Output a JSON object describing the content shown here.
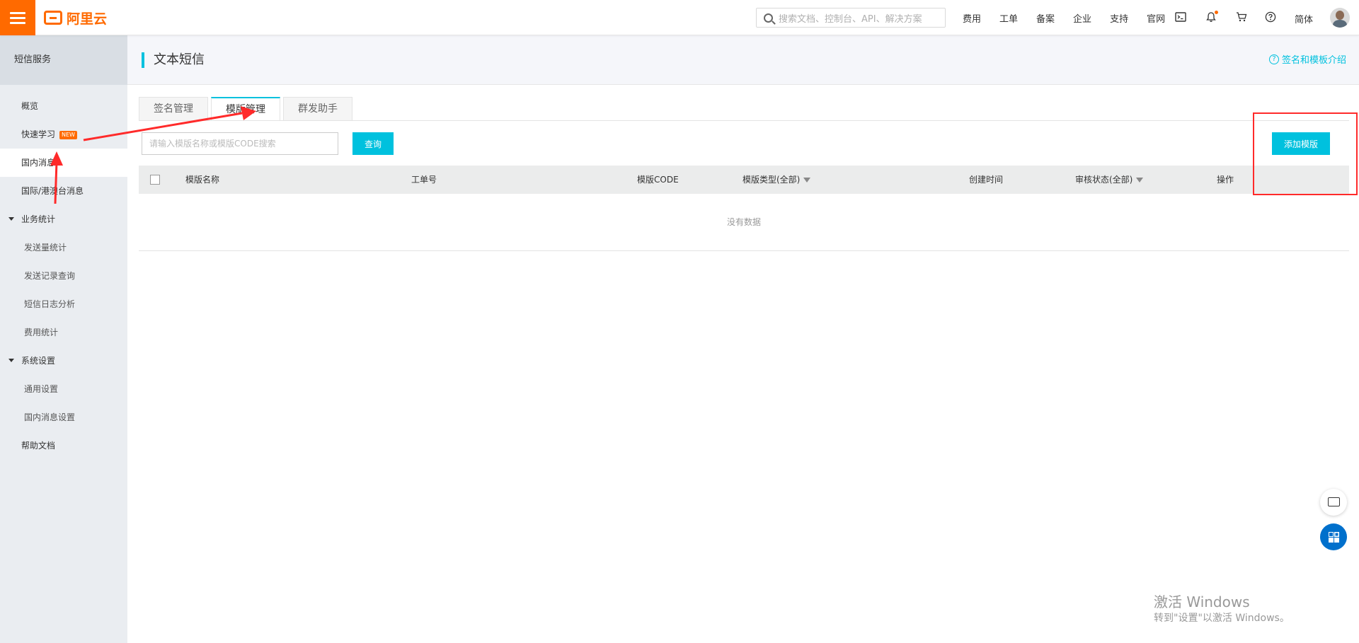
{
  "topbar": {
    "logo_text": "阿里云",
    "search_placeholder": "搜索文档、控制台、API、解决方案",
    "links": [
      "费用",
      "工单",
      "备案",
      "企业",
      "支持",
      "官网"
    ],
    "lang": "简体",
    "accent_color": "#ff6a00"
  },
  "sidebar": {
    "title": "短信服务",
    "items": [
      {
        "label": "概览"
      },
      {
        "label": "快速学习",
        "badge": "NEW"
      },
      {
        "label": "国内消息"
      },
      {
        "label": "国际/港澳台消息"
      }
    ],
    "stats_group": "业务统计",
    "stats_items": [
      "发送量统计",
      "发送记录查询",
      "短信日志分析",
      "费用统计"
    ],
    "settings_group": "系统设置",
    "settings_items": [
      "通用设置",
      "国内消息设置"
    ],
    "help": "帮助文档"
  },
  "header": {
    "title": "文本短信",
    "help_link": "签名和模板介绍"
  },
  "tabs": [
    "签名管理",
    "模版管理",
    "群发助手"
  ],
  "toolbar": {
    "search_placeholder": "请输入模版名称或模版CODE搜索",
    "query_label": "查询",
    "add_label": "添加模版",
    "primary_color": "#00c1de"
  },
  "table": {
    "columns": [
      "模版名称",
      "工单号",
      "模版CODE",
      "模版类型(全部)",
      "创建时间",
      "审核状态(全部)",
      "操作"
    ],
    "empty_text": "没有数据"
  },
  "watermark": {
    "title": "激活 Windows",
    "subtitle": "转到\"设置\"以激活 Windows。"
  }
}
